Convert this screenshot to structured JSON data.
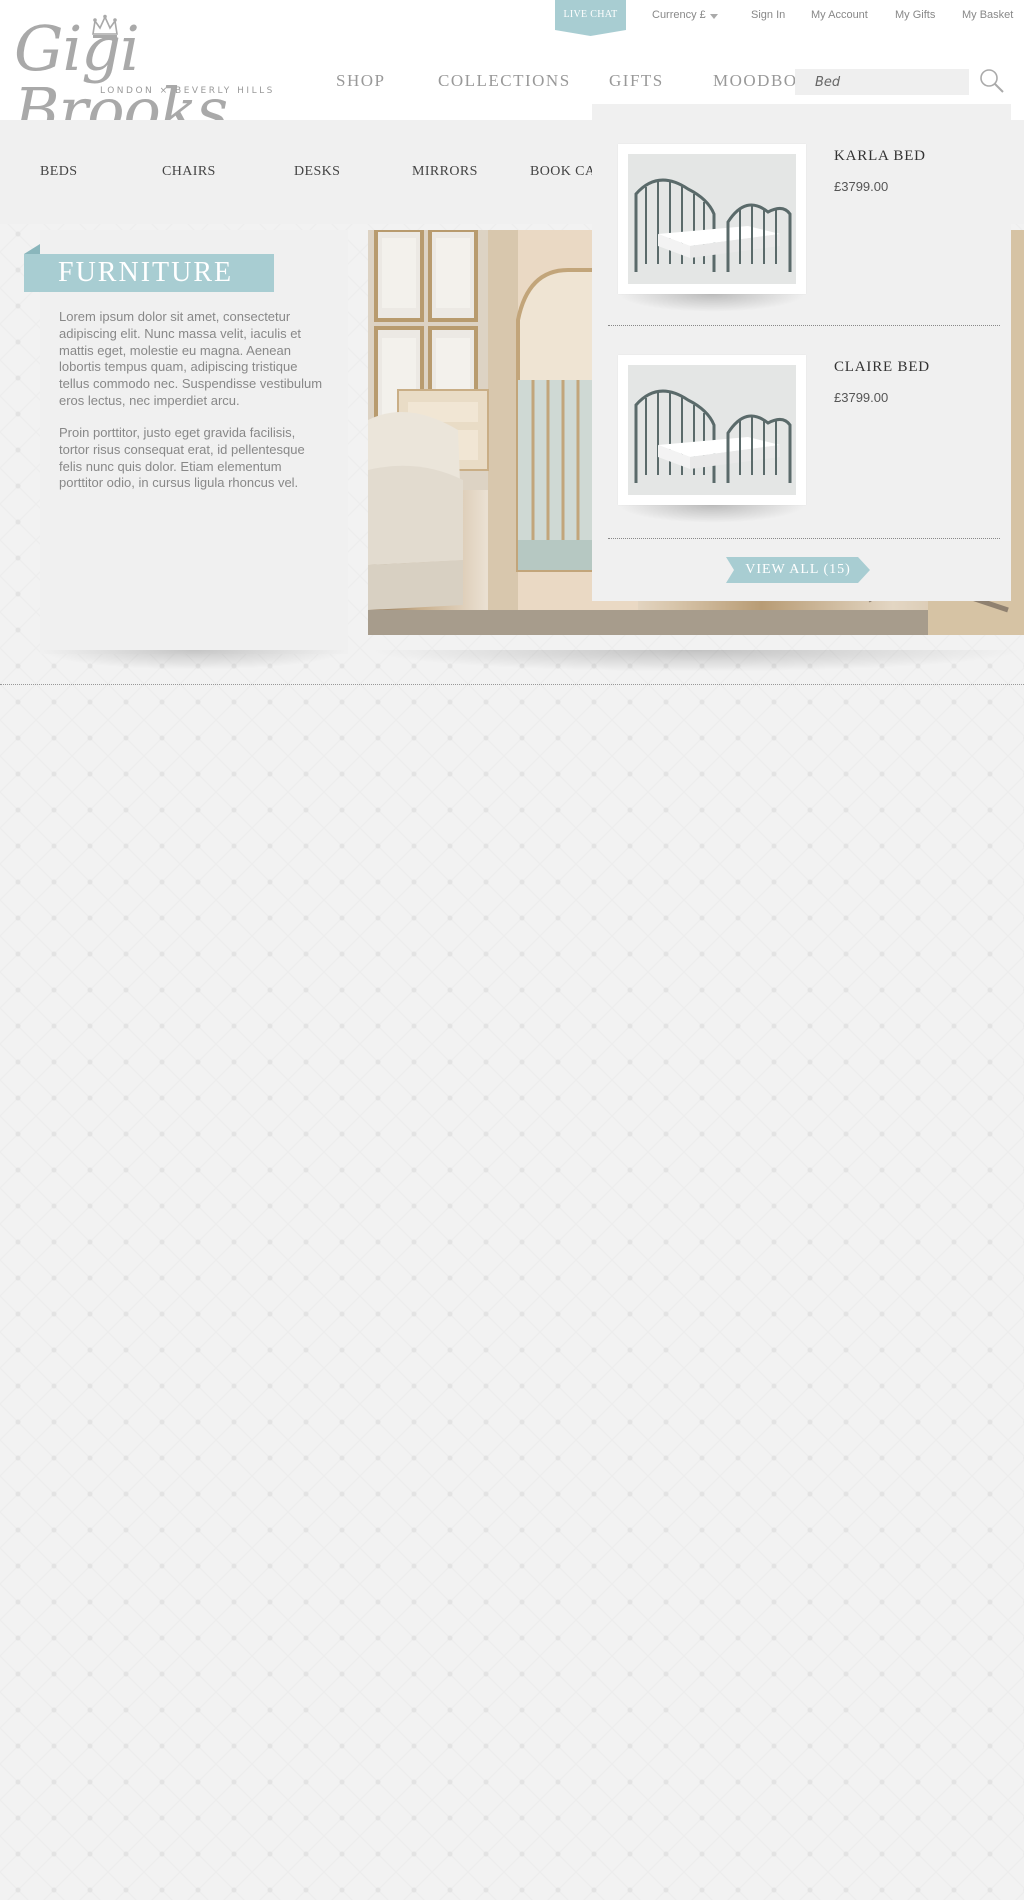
{
  "brand": {
    "name": "Gigi Brooks",
    "tagline": "LONDON × BEVERLY HILLS"
  },
  "topbar": {
    "live_chat": "LIVE CHAT",
    "currency": "Currency £",
    "sign_in": "Sign In",
    "my_account": "My Account",
    "my_gifts": "My Gifts",
    "my_basket": "My Basket"
  },
  "main_nav": {
    "shop": "SHOP",
    "collections": "COLLECTIONS",
    "gifts": "GIFTS",
    "moodboards": "MOODBOA"
  },
  "search": {
    "value": "Bed"
  },
  "sub_nav": {
    "beds": "BEDS",
    "chairs": "CHAIRS",
    "desks": "DESKS",
    "mirrors": "MIRRORS",
    "book_cases": "BOOK CAS"
  },
  "section": {
    "title": "FURNITURE",
    "paragraph_1": "Lorem ipsum dolor sit amet, consectetur adipiscing elit. Nunc massa velit, iaculis et mattis eget, molestie eu magna. Aenean lobortis tempus quam, adipiscing tristique tellus commodo nec. Suspendisse vestibulum eros lectus, nec imperdiet arcu.",
    "paragraph_2": "Proin porttitor, justo eget gravida facilisis, tortor risus consequat erat, id pellentesque felis nunc quis dolor. Etiam elementum porttitor odio, in cursus ligula rhoncus vel."
  },
  "search_results": {
    "items": [
      {
        "name": "KARLA BED",
        "price": "£3799.00"
      },
      {
        "name": "CLAIRE BED",
        "price": "£3799.00"
      }
    ],
    "view_all": "VIEW ALL (15)"
  },
  "colors": {
    "accent": "#a8cdd2",
    "accent_dark": "#8ab6bc",
    "panel_bg": "#f0f0f0",
    "text_muted": "#888888"
  },
  "icons": {
    "search": "search-icon",
    "currency_dropdown": "chevron-down-icon",
    "logo_crown": "crown-icon"
  }
}
